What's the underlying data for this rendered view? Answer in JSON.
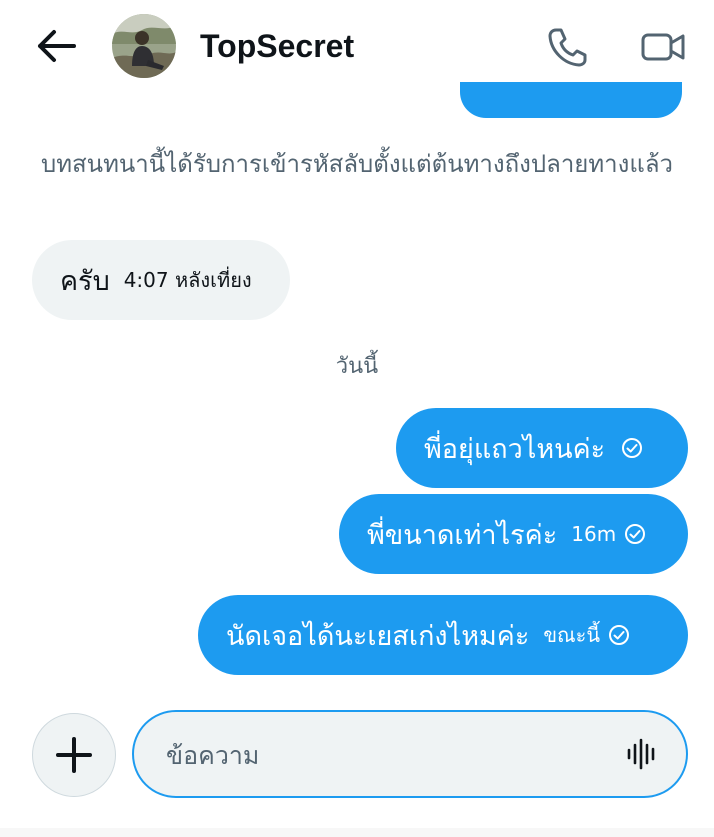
{
  "header": {
    "contact_name": "TopSecret",
    "back_icon": "arrow-left-icon",
    "call_icon": "phone-icon",
    "video_icon": "video-camera-icon"
  },
  "conversation": {
    "encryption_notice": "บทสนทนานี้ได้รับการเข้ารหัสลับตั้งแต่ต้นทางถึงปลายทางแล้ว",
    "incoming": [
      {
        "text": "ครับ",
        "time": "4:07 หลังเที่ยง"
      }
    ],
    "date_separator": "วันนี้",
    "outgoing": [
      {
        "text": "พี่อยุ่แถวไหนค่ะ",
        "time": "",
        "status_icon": "check-circle-icon"
      },
      {
        "text": "พี่ขนาดเท่าไรค่ะ",
        "time": "16m",
        "status_icon": "check-circle-icon"
      },
      {
        "text": "นัดเจอได้นะเยสเก่งไหมค่ะ",
        "time": "ขณะนี้",
        "status_icon": "check-circle-icon"
      }
    ]
  },
  "composer": {
    "placeholder": "ข้อความ",
    "value": "",
    "add_icon": "plus-icon",
    "mic_icon": "voice-waveform-icon"
  },
  "colors": {
    "accent": "#1d9bf0",
    "incoming_bubble": "#eff3f4",
    "secondary_text": "#536471"
  }
}
